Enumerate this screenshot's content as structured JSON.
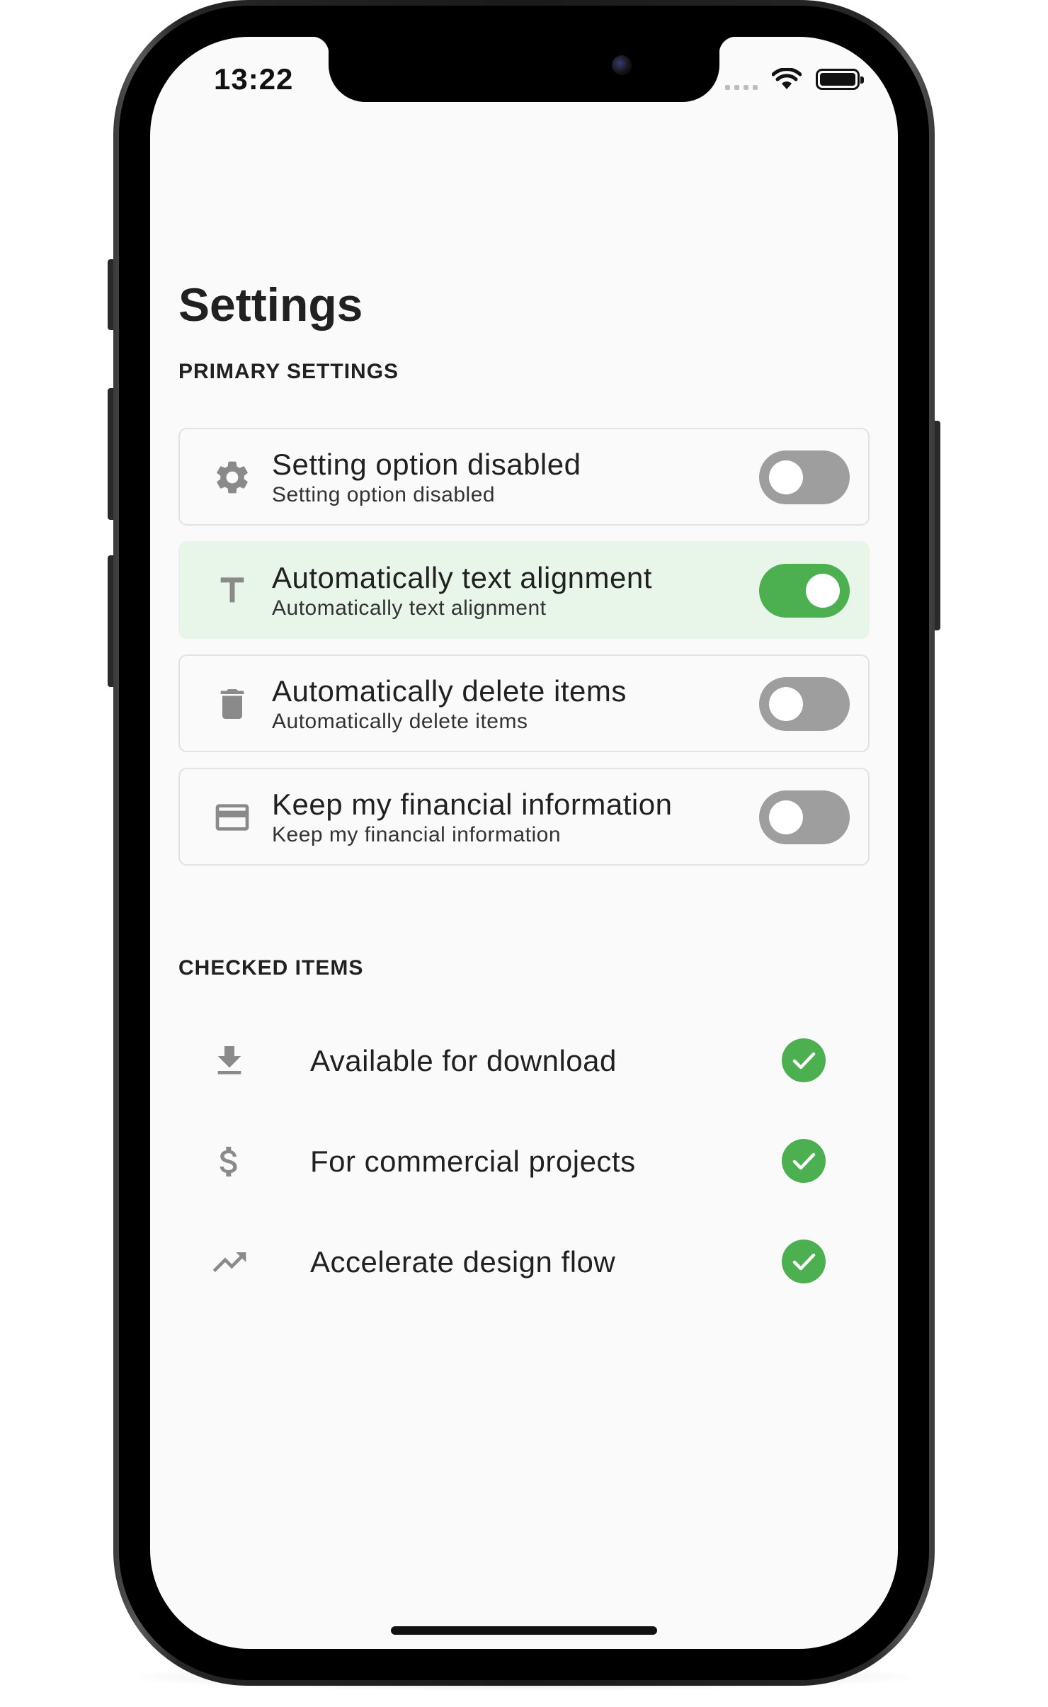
{
  "status_bar": {
    "time": "13:22"
  },
  "page": {
    "title": "Settings"
  },
  "primary_settings": {
    "label": "PRIMARY SETTINGS",
    "items": [
      {
        "title": "Setting option disabled",
        "subtitle": "Setting option disabled",
        "icon": "gear-icon",
        "enabled": false
      },
      {
        "title": "Automatically text alignment",
        "subtitle": "Automatically text alignment",
        "icon": "text-icon",
        "enabled": true
      },
      {
        "title": "Automatically delete items",
        "subtitle": "Automatically delete items",
        "icon": "trash-icon",
        "enabled": false
      },
      {
        "title": "Keep my financial information",
        "subtitle": "Keep my financial information",
        "icon": "credit-card-icon",
        "enabled": false
      }
    ]
  },
  "checked_items": {
    "label": "CHECKED ITEMS",
    "items": [
      {
        "label": "Available for download",
        "icon": "download-icon",
        "checked": true
      },
      {
        "label": "For commercial projects",
        "icon": "dollar-icon",
        "checked": true
      },
      {
        "label": "Accelerate design flow",
        "icon": "trending-up-icon",
        "checked": true
      }
    ]
  },
  "colors": {
    "accent": "#4caf50",
    "active_row_background": "#e8f5e9",
    "toggle_off": "#9e9e9e",
    "icon_gray": "#8a8a8a"
  }
}
